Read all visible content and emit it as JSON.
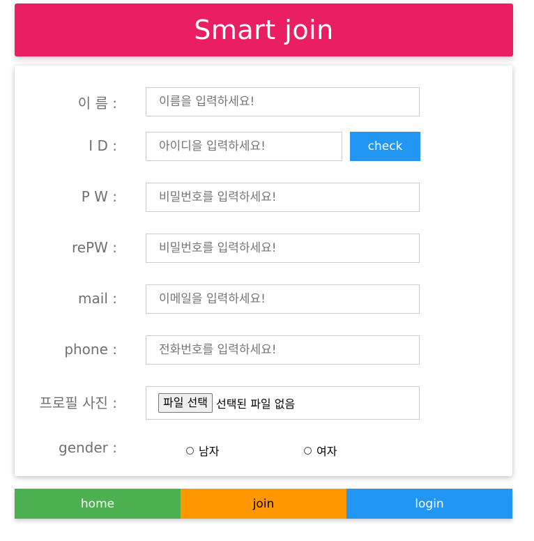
{
  "header": {
    "title": "Smart join"
  },
  "form": {
    "name": {
      "label": "이 름 :",
      "placeholder": "이름을 입력하세요!"
    },
    "id": {
      "label": "I D :",
      "placeholder": "아이디을 입력하세요!",
      "check_label": "check"
    },
    "pw": {
      "label": "P W :",
      "placeholder": "비밀번호를 입력하세요!"
    },
    "repw": {
      "label": "rePW :",
      "placeholder": "비밀번호를 입력하세요!"
    },
    "mail": {
      "label": "mail :",
      "placeholder": "이메일을 입력하세요!"
    },
    "phone": {
      "label": "phone :",
      "placeholder": "전화번호를 입력하세요!"
    },
    "photo": {
      "label": "프로필 사진 :",
      "button_label": "파일 선택",
      "status": "선택된 파일 없음"
    },
    "gender": {
      "label": "gender :",
      "options": [
        "남자",
        "여자"
      ]
    }
  },
  "nav": {
    "items": [
      "home",
      "join",
      "login"
    ]
  },
  "colors": {
    "header_bg": "#e91e63",
    "check_bg": "#2196f3",
    "home_bg": "#4caf50",
    "join_bg": "#ff9800",
    "login_bg": "#2196f3"
  }
}
